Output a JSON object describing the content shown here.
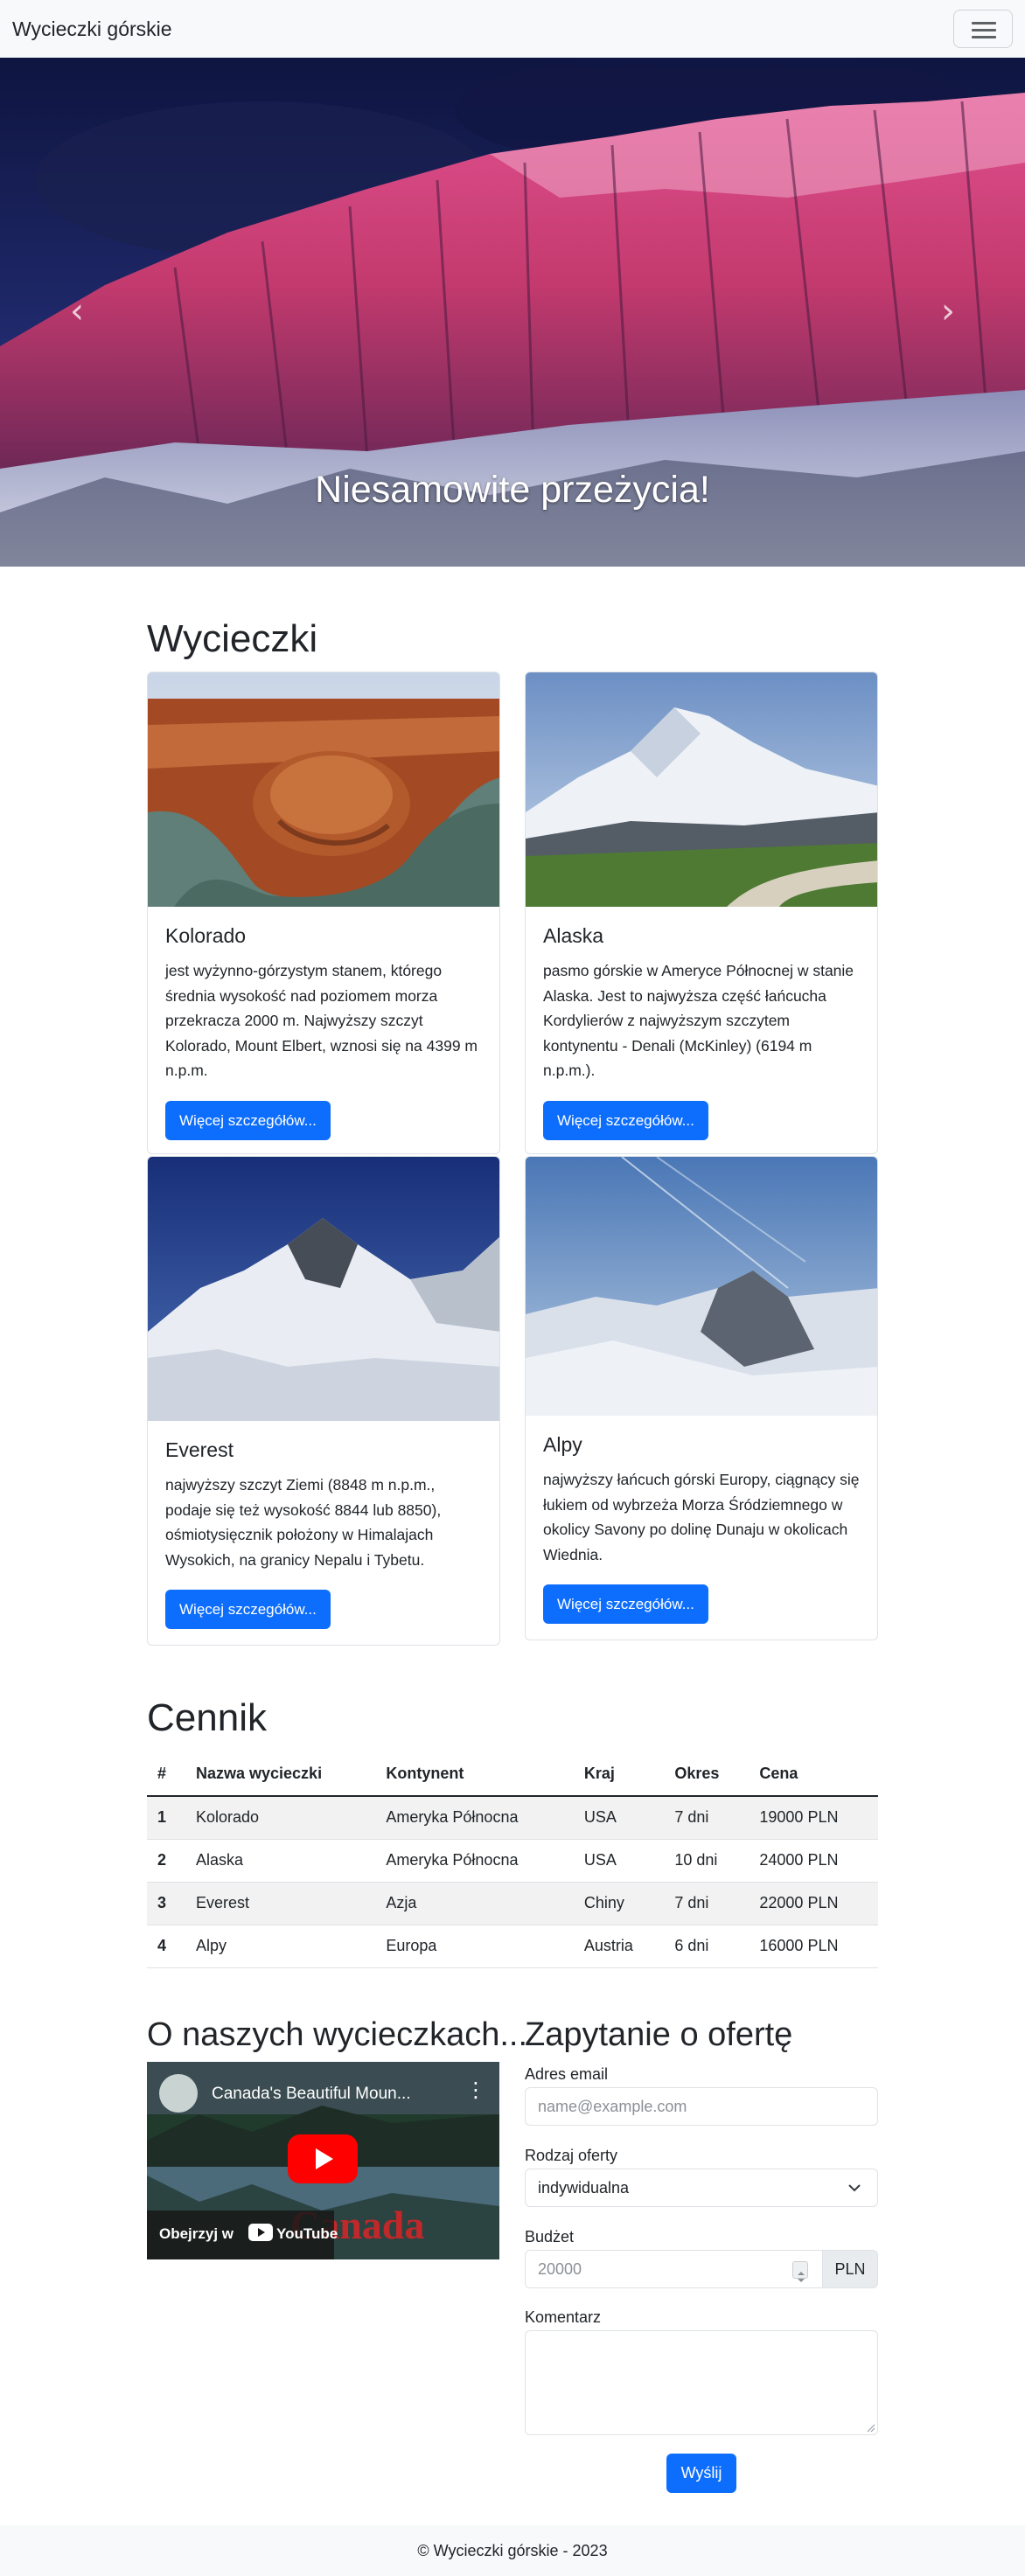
{
  "navbar": {
    "brand": "Wycieczki górskie",
    "menu_icon": "hamburger-icon"
  },
  "carousel": {
    "caption": "Niesamowite przeżycia!",
    "prev_icon": "chevron-left-icon",
    "next_icon": "chevron-right-icon"
  },
  "trips": {
    "heading": "Wycieczki",
    "cards": [
      {
        "title": "Kolorado",
        "text": "jest wyżynno-górzystym stanem, którego średnia wysokość nad poziomem morza przekracza 2000 m. Najwyższy szczyt Kolorado, Mount Elbert, wznosi się na 4399 m n.p.m.",
        "button": "Więcej szczegółów..."
      },
      {
        "title": "Alaska",
        "text": "pasmo górskie w Ameryce Północnej w stanie Alaska. Jest to najwyższa część łańcucha Kordylierów z najwyższym szczytem kontynentu - Denali (McKinley) (6194 m n.p.m.).",
        "button": "Więcej szczegółów..."
      },
      {
        "title": "Everest",
        "text": "najwyższy szczyt Ziemi (8848 m n.p.m., podaje się też wysokość 8844 lub 8850), ośmiotysięcznik położony w Himalajach Wysokich, na granicy Nepalu i Tybetu.",
        "button": "Więcej szczegółów..."
      },
      {
        "title": "Alpy",
        "text": "najwyższy łańcuch górski Europy, ciągnący się łukiem od wybrzeża Morza Śródziemnego w okolicy Savony po dolinę Dunaju w okolicach Wiednia.",
        "button": "Więcej szczegółów..."
      }
    ]
  },
  "pricing": {
    "heading": "Cennik",
    "columns": [
      "#",
      "Nazwa wycieczki",
      "Kontynent",
      "Kraj",
      "Okres",
      "Cena"
    ],
    "rows": [
      [
        "1",
        "Kolorado",
        "Ameryka Północna",
        "USA",
        "7 dni",
        "19000 PLN"
      ],
      [
        "2",
        "Alaska",
        "Ameryka Północna",
        "USA",
        "10 dni",
        "24000 PLN"
      ],
      [
        "3",
        "Everest",
        "Azja",
        "Chiny",
        "7 dni",
        "22000 PLN"
      ],
      [
        "4",
        "Alpy",
        "Europa",
        "Austria",
        "6 dni",
        "16000 PLN"
      ]
    ]
  },
  "about": {
    "heading": "O naszych wycieczkach...",
    "video": {
      "title": "Canada's Beautiful Moun...",
      "watch_on": "Obejrzyj w",
      "platform": "YouTube",
      "overlay_text": "Canada"
    }
  },
  "form": {
    "heading": "Zapytanie o ofertę",
    "email_label": "Adres email",
    "email_placeholder": "name@example.com",
    "type_label": "Rodzaj oferty",
    "type_value": "indywidualna",
    "budget_label": "Budżet",
    "budget_placeholder": "20000",
    "budget_unit": "PLN",
    "comment_label": "Komentarz",
    "submit": "Wyślij"
  },
  "footer": {
    "text": "© Wycieczki górskie - 2023"
  }
}
